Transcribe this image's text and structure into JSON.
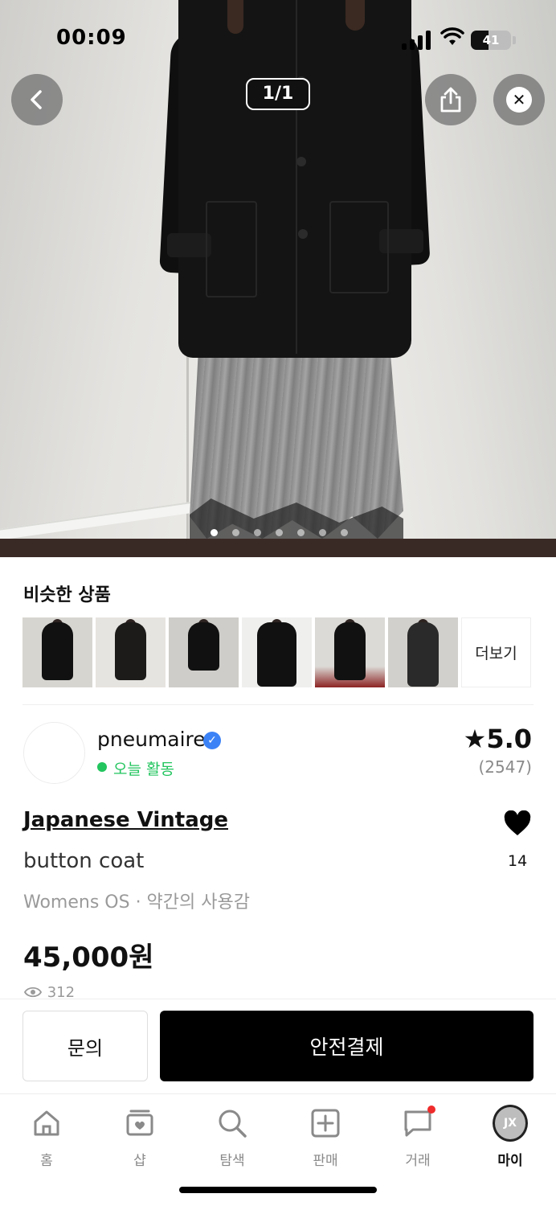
{
  "status_bar": {
    "time": "00:09",
    "battery": "41"
  },
  "gallery": {
    "counter": "1/1",
    "dot_count": 7,
    "active_dot": 0
  },
  "similar": {
    "title": "비슷한 상품",
    "more_label": "더보기",
    "thumb_count": 6
  },
  "seller": {
    "name": "pneumaire",
    "activity": "오늘 활동",
    "rating": "★5.0",
    "review_count": "(2547)",
    "colors": {
      "active": "#22c55e",
      "verified": "#3b82f6"
    }
  },
  "product": {
    "brand": "Japanese Vintage",
    "name": "button coat",
    "meta": "Womens OS · 약간의 사용감",
    "price": "45,000원",
    "likes": "14",
    "views": "312"
  },
  "actions": {
    "inquiry": "문의",
    "pay": "안전결제"
  },
  "tabs": [
    {
      "label": "홈",
      "icon": "home-icon"
    },
    {
      "label": "샵",
      "icon": "shop-icon"
    },
    {
      "label": "탐색",
      "icon": "search-icon"
    },
    {
      "label": "판매",
      "icon": "plus-square-icon"
    },
    {
      "label": "거래",
      "icon": "chat-icon"
    },
    {
      "label": "마이",
      "icon": "profile-avatar",
      "avatar_text": "JX"
    }
  ]
}
